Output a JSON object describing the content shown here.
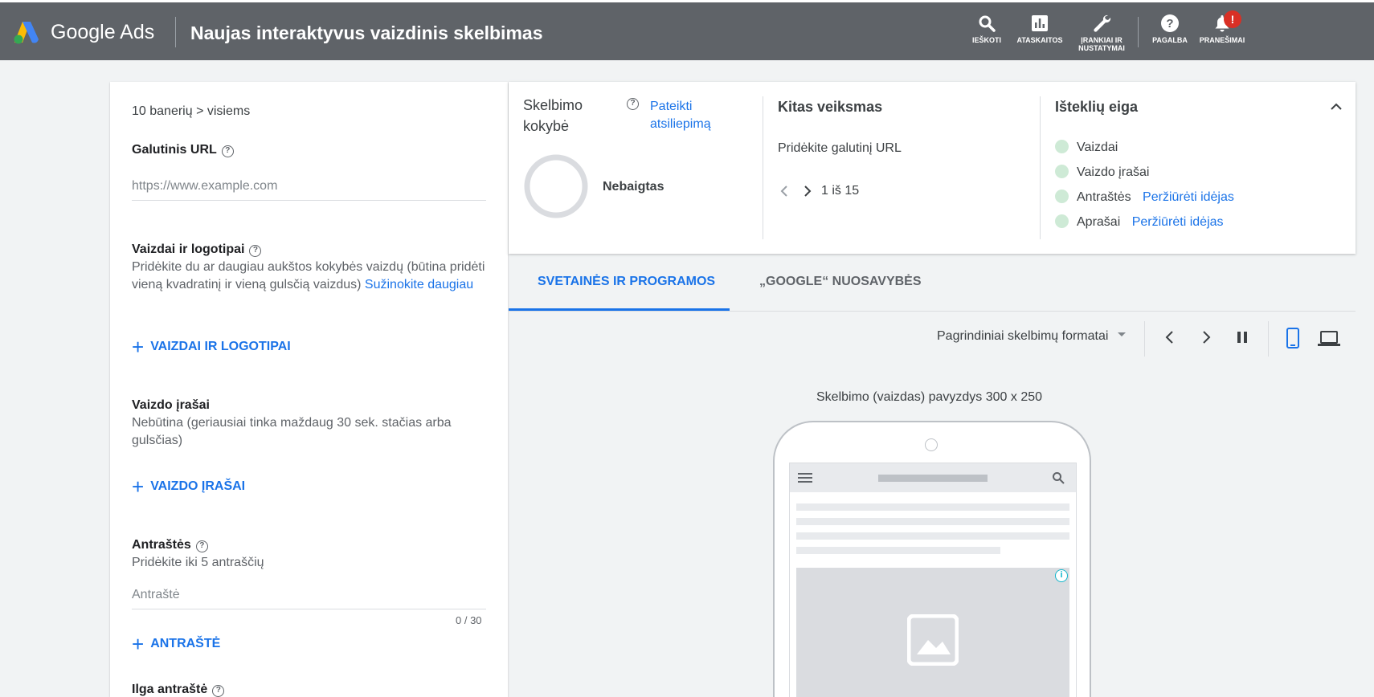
{
  "header": {
    "brand": "Google Ads",
    "title": "Naujas interaktyvus vaizdinis skelbimas",
    "buttons": [
      {
        "label": "IEŠKOTI",
        "icon": "search-icon"
      },
      {
        "label": "ATASKAITOS",
        "icon": "reports-icon"
      },
      {
        "label": "ĮRANKIAI IR NUSTATYMAI",
        "icon": "wrench-icon"
      },
      {
        "label": "PAGALBA",
        "icon": "help-icon"
      },
      {
        "label": "PRANEŠIMAI",
        "icon": "bell-icon"
      }
    ],
    "notification_badge": "!"
  },
  "left": {
    "breadcrumb": "10 banerių > visiems",
    "final_url_label": "Galutinis URL",
    "final_url_placeholder": "https://www.example.com",
    "images_label": "Vaizdai ir logotipai",
    "images_desc": "Pridėkite du ar daugiau aukštos kokybės vaizdų (būtina pridėti vieną kvadratinį ir vieną gulsčią vaizdus)",
    "images_link": "Sužinokite daugiau",
    "images_add": "VAIZDAI IR LOGOTIPAI",
    "videos_label": "Vaizdo įrašai",
    "videos_desc": "Nebūtina (geriausiai tinka maždaug 30 sek. stačias arba gulsčias)",
    "videos_add": "VAIZDO ĮRAŠAI",
    "headlines_label": "Antraštės",
    "headlines_desc": "Pridėkite iki 5 antraščių",
    "headline_placeholder": "Antraštė",
    "headline_counter": "0 / 30",
    "headlines_add": "ANTRAŠTĖ",
    "long_headline_label": "Ilga antraštė"
  },
  "summary": {
    "quality_title": "Skelbimo kokybė",
    "feedback_link": "Pateikti atsiliepimą",
    "quality_status": "Nebaigtas",
    "next_title": "Kitas veiksmas",
    "next_text": "Pridėkite galutinį URL",
    "pager": "1 iš 15",
    "assets_title": "Išteklių eiga",
    "assets": [
      {
        "label": "Vaizdai",
        "link": ""
      },
      {
        "label": "Vaizdo įrašai",
        "link": ""
      },
      {
        "label": "Antraštės",
        "link": "Peržiūrėti idėjas"
      },
      {
        "label": "Aprašai",
        "link": "Peržiūrėti idėjas"
      }
    ]
  },
  "tabs": [
    {
      "label": "SVETAINĖS IR PROGRAMOS",
      "active": true
    },
    {
      "label": "„GOOGLE“ NUOSAVYBĖS",
      "active": false
    }
  ],
  "preview": {
    "format_select": "Pagrindiniai skelbimų formatai",
    "sample_label": "Skelbimo (vaizdas) pavyzdys 300 x 250"
  },
  "colors": {
    "header_bg": "#5f6368",
    "accent": "#1a73e8",
    "asset_dot": "#ceead6",
    "badge": "#d93025"
  }
}
